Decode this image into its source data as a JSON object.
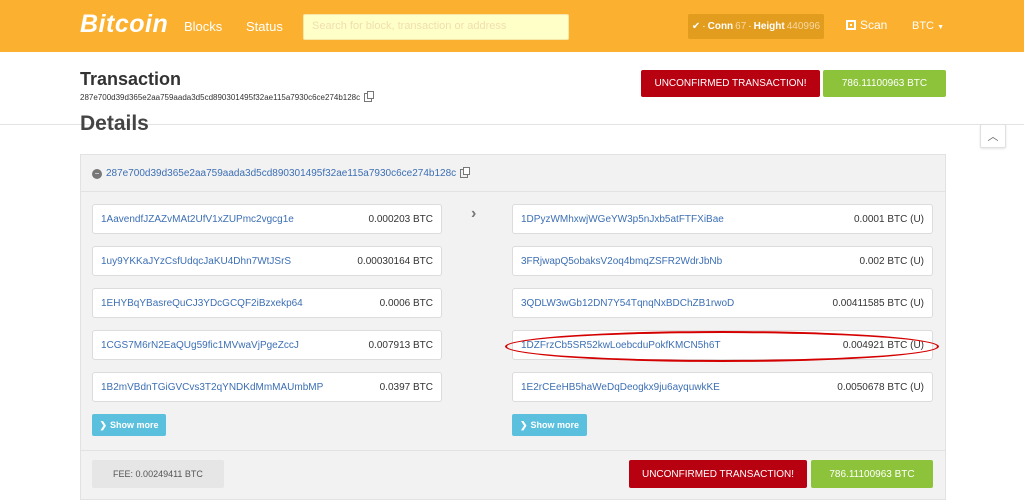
{
  "nav": {
    "brand": "Bitcoin",
    "blocks": "Blocks",
    "status": "Status",
    "search_placeholder": "Search for block, transaction or address",
    "conn_label": "Conn",
    "conn_value": "67",
    "height_label": "Height",
    "height_value": "440996",
    "scan": "Scan",
    "currency": "BTC"
  },
  "header": {
    "title": "Transaction",
    "txid": "287e700d39d365e2aa759aada3d5cd890301495f32ae115a7930c6ce274b128c",
    "unconfirmed": "UNCONFIRMED TRANSACTION!",
    "amount": "786.11100963 BTC"
  },
  "details": {
    "heading": "Details",
    "txid": "287e700d39d365e2aa759aada3d5cd890301495f32ae115a7930c6ce274b128c",
    "inputs": [
      {
        "address": "1AavendfJZAZvMAt2UfV1xZUPmc2vgcg1e",
        "amount": "0.000203 BTC"
      },
      {
        "address": "1uy9YKKaJYzCsfUdqcJaKU4Dhn7WtJSrS",
        "amount": "0.00030164 BTC"
      },
      {
        "address": "1EHYBqYBasreQuCJ3YDcGCQF2iBzxekp64",
        "amount": "0.0006 BTC"
      },
      {
        "address": "1CGS7M6rN2EaQUg59fic1MVwaVjPgeZccJ",
        "amount": "0.007913 BTC"
      },
      {
        "address": "1B2mVBdnTGiGVCvs3T2qYNDKdMmMAUmbMP",
        "amount": "0.0397 BTC"
      }
    ],
    "outputs": [
      {
        "address": "1DPyzWMhxwjWGeYW3p5nJxb5atFTFXiBae",
        "amount": "0.0001 BTC (U)"
      },
      {
        "address": "3FRjwapQ5obaksV2oq4bmqZSFR2WdrJbNb",
        "amount": "0.002 BTC (U)"
      },
      {
        "address": "3QDLW3wGb12DN7Y54TqnqNxBDChZB1rwoD",
        "amount": "0.00411585 BTC (U)"
      },
      {
        "address": "1DZFrzCb5SR52kwLoebcduPokfKMCN5h6T",
        "amount": "0.004921 BTC (U)"
      },
      {
        "address": "1E2rCEeHB5haWeDqDeogkx9ju6ayquwkKE",
        "amount": "0.0050678 BTC (U)"
      }
    ],
    "show_more": "Show more",
    "fee": "FEE: 0.00249411 BTC",
    "unconfirmed": "UNCONFIRMED TRANSACTION!",
    "amount": "786.11100963 BTC"
  },
  "colors": {
    "topbar": "#fbb12f",
    "link": "#3c6fb4",
    "danger": "#b70010",
    "success": "#8dc33a",
    "info": "#5bc0de",
    "highlight": "#d40000"
  }
}
